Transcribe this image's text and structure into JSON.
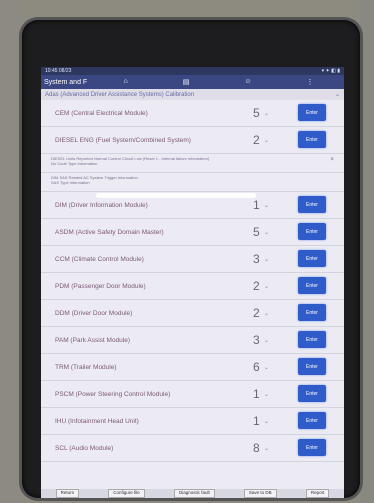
{
  "status": {
    "time": "10:45 08/23",
    "icons": "▾ ✦ ◧ ▮"
  },
  "app": {
    "title": "System and F"
  },
  "section": {
    "title": "Adas (Advanced Driver Assistance Systems) Calibration"
  },
  "info_lines": [
    "DIESEL Units Reported Normal Control Circuit Low (Reset 1 - Internal failure information)",
    "No Code Type information",
    "DIM SAS Related AC System                 Trigger information",
    "SAS Type information"
  ],
  "modules": [
    {
      "label": "CEM (Central Electrical Module)",
      "value": "5",
      "enter": "Enter"
    },
    {
      "label": "DIESEL ENG (Fuel System/Combined System)",
      "value": "2",
      "enter": "Enter"
    },
    {
      "label": "DIM (Driver Information Module)",
      "value": "1",
      "enter": "Enter"
    },
    {
      "label": "ASDM (Active Safety Domain Master)",
      "value": "5",
      "enter": "Enter"
    },
    {
      "label": "CCM (Climate Control Module)",
      "value": "3",
      "enter": "Enter"
    },
    {
      "label": "PDM (Passenger Door Module)",
      "value": "2",
      "enter": "Enter"
    },
    {
      "label": "DDM (Driver Door Module)",
      "value": "2",
      "enter": "Enter"
    },
    {
      "label": "PAM (Park Assist Module)",
      "value": "3",
      "enter": "Enter"
    },
    {
      "label": "TRM (Trailer Module)",
      "value": "6",
      "enter": "Enter"
    },
    {
      "label": "PSCM (Power Steering Control Module)",
      "value": "1",
      "enter": "Enter"
    },
    {
      "label": "IHU (Infotainment Head Unit)",
      "value": "1",
      "enter": "Enter"
    },
    {
      "label": "SCL (Audio Module)",
      "value": "8",
      "enter": "Enter"
    }
  ],
  "bottom": [
    "Return",
    "Configure file",
    "Diagnostic fault",
    "Save to DB",
    "Report"
  ]
}
